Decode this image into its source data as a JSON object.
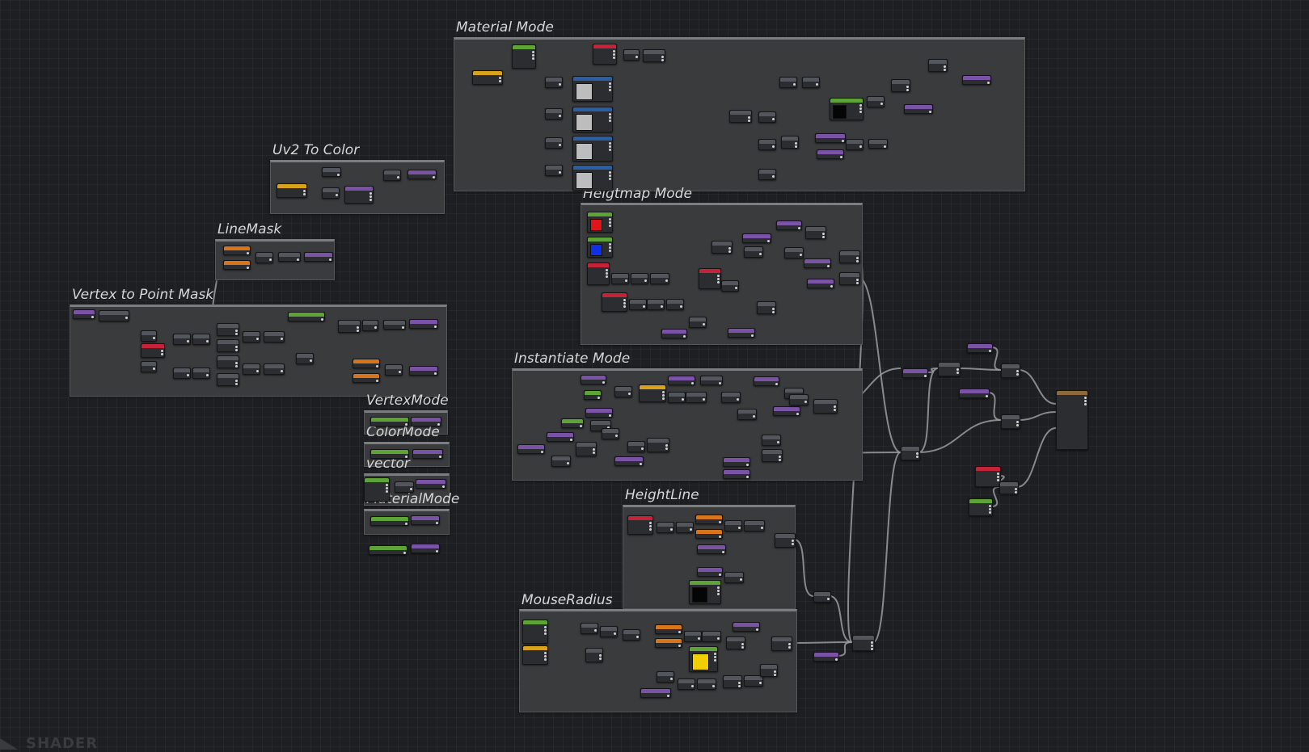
{
  "canvas": {
    "groups": [
      {
        "id": "material-mode",
        "title": "Material Mode"
      },
      {
        "id": "uv2-to-color",
        "title": "Uv2 To Color"
      },
      {
        "id": "line-mask",
        "title": "LineMask"
      },
      {
        "id": "vertex-to-point-mask",
        "title": "Vertex to Point Mask"
      },
      {
        "id": "heightmap-mode",
        "title": "Heigtmap Mode"
      },
      {
        "id": "instantiate-mode",
        "title": "Instantiate Mode"
      },
      {
        "id": "vertex-mode",
        "title": "VertexMode"
      },
      {
        "id": "color-mode",
        "title": "ColorMode"
      },
      {
        "id": "vector",
        "title": "vector"
      },
      {
        "id": "material-mode-2",
        "title": "MaterialMode"
      },
      {
        "id": "height-line",
        "title": "HeightLine"
      },
      {
        "id": "mouse-radius",
        "title": "MouseRadius"
      }
    ]
  },
  "footer": {
    "watermark": "SHADER"
  },
  "colors": {
    "background": "#1e1f22",
    "group_body": "#3a3b3d",
    "node_body": "#2c2d30",
    "wire": "#9a9c9f",
    "header_gray": "#53565c",
    "header_purple": "#7a53a6",
    "header_orange": "#d6751c",
    "header_green": "#5da335",
    "header_blue": "#2c5ea3",
    "header_red": "#c42338",
    "header_yellow": "#d9a21c",
    "swatch_red": "#e0141c",
    "swatch_blue": "#1030e6",
    "swatch_yellow": "#f0d000"
  }
}
